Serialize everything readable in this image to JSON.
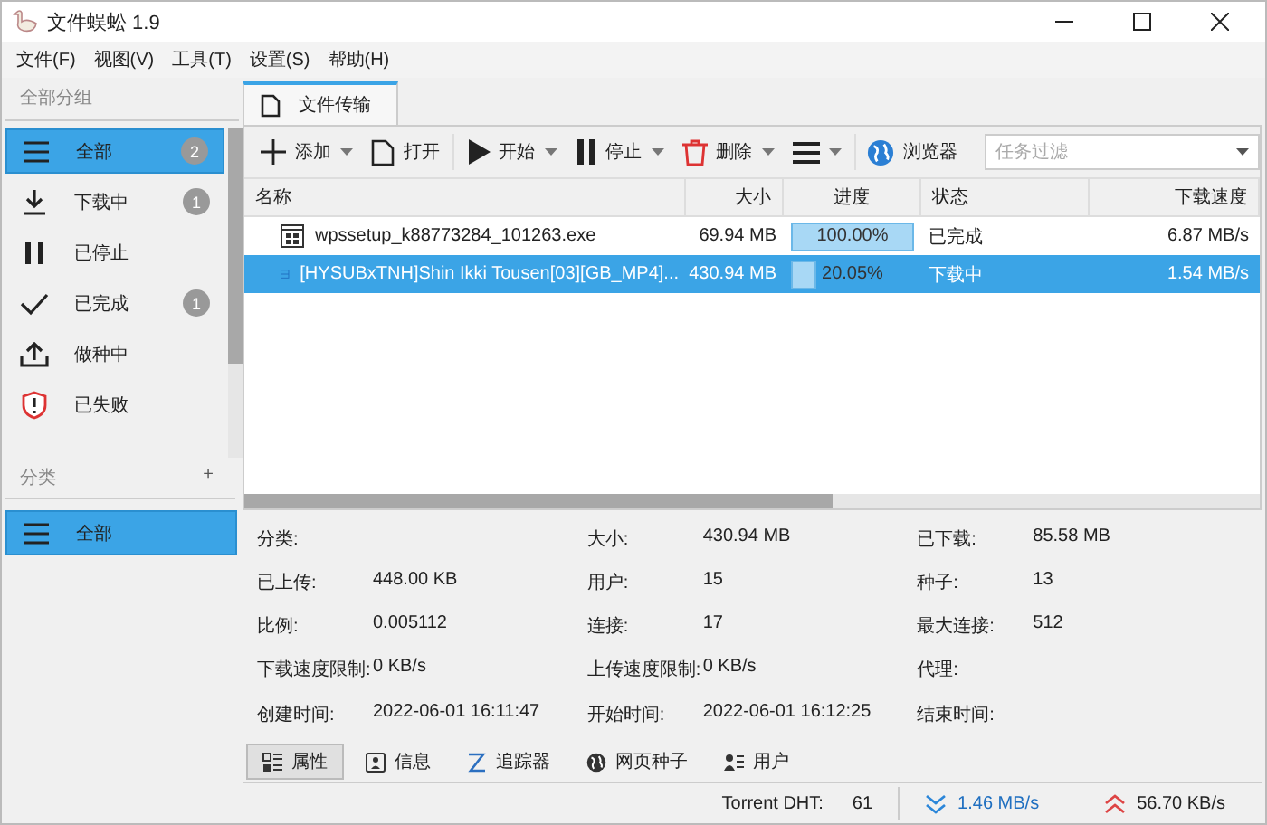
{
  "window": {
    "title": "文件蜈蚣 1.9"
  },
  "menu": [
    "文件(F)",
    "视图(V)",
    "工具(T)",
    "设置(S)",
    "帮助(H)"
  ],
  "sidebar": {
    "header": "全部分组",
    "items": [
      {
        "label": "全部",
        "badge": "2",
        "selected": true
      },
      {
        "label": "下载中",
        "badge": "1",
        "selected": false
      },
      {
        "label": "已停止",
        "selected": false
      },
      {
        "label": "已完成",
        "badge": "1",
        "selected": false
      },
      {
        "label": "做种中",
        "selected": false
      },
      {
        "label": "已失败",
        "selected": false
      }
    ],
    "category_header": "分类",
    "add": "+",
    "categories": [
      {
        "label": "全部",
        "selected": true
      }
    ]
  },
  "tab": {
    "label": "文件传输"
  },
  "toolbar": {
    "buttons": [
      {
        "label": "添加",
        "dropdown": true
      },
      {
        "label": "打开",
        "dropdown": false
      },
      {
        "label": "开始",
        "dropdown": true
      },
      {
        "label": "停止",
        "dropdown": true
      },
      {
        "label": "删除",
        "dropdown": true
      },
      {
        "dropdown": true
      },
      {
        "label": "浏览器",
        "dropdown": false
      }
    ],
    "filter": {
      "placeholder": "任务过滤"
    }
  },
  "table": {
    "columns": [
      "名称",
      "大小",
      "进度",
      "状态",
      "下载速度"
    ],
    "rows": [
      {
        "name": "wpssetup_k88773284_101263.exe",
        "size": "69.94 MB",
        "level": 1.0,
        "progress": "100.00%",
        "status": "已完成",
        "speed": "6.87 MB/s",
        "selected": false
      },
      {
        "name": "[HYSUBxTNH]Shin Ikki Tousen[03][GB_MP4]...",
        "size": "430.94 MB",
        "level": 0.2005,
        "progress": "20.05%",
        "status": "下载中",
        "speed": "1.54 MB/s",
        "selected": true
      }
    ]
  },
  "details": [
    [
      {
        "label": "分类:"
      },
      {
        "label": "大小:",
        "value": "430.94 MB"
      },
      {
        "label": "已下载:",
        "value": "85.58 MB"
      }
    ],
    [
      {
        "label": "已上传:",
        "value": "448.00 KB"
      },
      {
        "label": "用户:",
        "value": "15"
      },
      {
        "label": "种子:",
        "value": "13"
      }
    ],
    [
      {
        "label": "比例:",
        "value": "0.005112"
      },
      {
        "label": "连接:",
        "value": "17"
      },
      {
        "label": "最大连接:",
        "value": "512"
      }
    ],
    [
      {
        "label": "下载速度限制:",
        "value": "0 KB/s"
      },
      {
        "label": "上传速度限制:",
        "value": "0 KB/s"
      },
      {
        "label": "代理:"
      }
    ],
    [
      {
        "label": "创建时间:",
        "value": "2022-06-01 16:11:47"
      },
      {
        "label": "开始时间:",
        "value": "2022-06-01 16:12:25"
      },
      {
        "label": "结束时间:"
      }
    ]
  ],
  "detail_tabs": [
    {
      "label": "属性",
      "selected": true
    },
    {
      "label": "信息",
      "selected": false
    },
    {
      "label": "追踪器",
      "selected": false
    },
    {
      "label": "网页种子",
      "selected": false
    },
    {
      "label": "用户",
      "selected": false
    }
  ],
  "status_bar": {
    "dht_label": "Torrent DHT:",
    "dht_value": "61",
    "down": "1.46 MB/s",
    "up": "56.70 KB/s"
  }
}
